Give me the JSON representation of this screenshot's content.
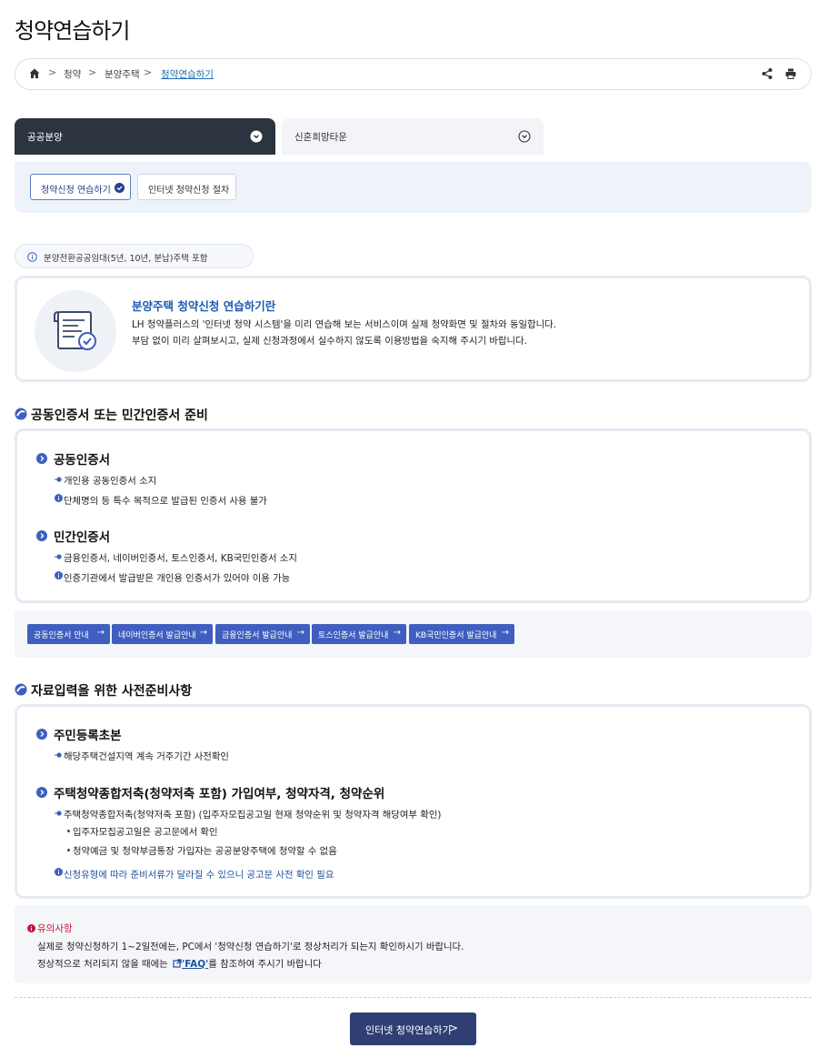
{
  "page": {
    "title": "청약연습하기"
  },
  "breadcrumb": {
    "items": [
      "청약",
      "분양주택",
      "청약연습하기"
    ],
    "separator": ">"
  },
  "tabs": [
    {
      "label": "공공분양",
      "active": true
    },
    {
      "label": "신혼희망타운",
      "active": false
    }
  ],
  "subtabs": [
    {
      "label": "청약신청 연습하기",
      "active": true
    },
    {
      "label": "인터넷 청약신청 절차",
      "active": false
    }
  ],
  "notice": {
    "text": "분양전환공공임대(5년, 10년, 분납)주택 포함"
  },
  "intro": {
    "title": "분양주택 청약신청 연습하기란",
    "lines": [
      "LH 청약플러스의 '인터넷 청약 시스템'을 미리 연습해 보는 서비스이며 실제 청약화면 및 절차와 동일합니다.",
      "부담 없이 미리 살펴보시고, 실제 신청과정에서 실수하지 않도록 이용방법을 숙지해 주시기 바랍니다."
    ]
  },
  "section_cert": {
    "title": "공동인증서 또는 민간인증서 준비",
    "items": [
      {
        "title": "공동인증서",
        "bullet": "개인용 공동인증서 소지",
        "info": "단체명의 등 특수 목적으로 발급된 인증서 사용 불가"
      },
      {
        "title": "민간인증서",
        "bullet": "금융인증서, 네이버인증서, 토스인증서, KB국민인증서 소지",
        "info": "인증기관에서 발급받은 개인용 인증서가 있어야 이용 가능"
      }
    ],
    "buttons": [
      "공동인증서 안내",
      "네이버인증서 발급안내",
      "금융인증서 발급안내",
      "토스인증서 발급안내",
      "KB국민인증서 발급안내"
    ]
  },
  "section_docs": {
    "title": "자료입력을 위한 사전준비사항",
    "item1": {
      "title": "주민등록초본",
      "bullet": "해당주택건설지역 계속 거주기간 사전확인"
    },
    "item2": {
      "title": "주택청약종합저축(청약저축 포함) 가입여부, 청약자격, 청약순위",
      "bullet": "주택청약종합저축(청약저축 포함) (입주자모집공고일 현재 청약순위 및 청약자격 해당여부 확인)",
      "subs": [
        "입주자모집공고일은 공고문에서 확인",
        "청약예금 및 청약부금통장 가입자는 공공분양주택에 청약할 수 없음"
      ],
      "info": "신청유형에 따라 준비서류가 달라질 수 있으니 공고문 사전 확인 필요"
    }
  },
  "caution": {
    "title": "유의사항",
    "line1": "실제로 청약신청하기 1~2일전에는, PC에서 '청약신청 연습하기'로 정상처리가 되는지 확인하시기 바랍니다.",
    "line2_pre": "정상적으로 처리되지 않을 때에는",
    "faq": "'FAQ'",
    "line2_post": "를 참조하여 주시기 바랍니다"
  },
  "cta": {
    "label": "인터넷 청약연습하기",
    "chevron": ">"
  },
  "colors": {
    "accent": "#3f5ec0",
    "dark_tab": "#2c3440",
    "cta": "#2f3f73",
    "caution": "#c0183a"
  }
}
